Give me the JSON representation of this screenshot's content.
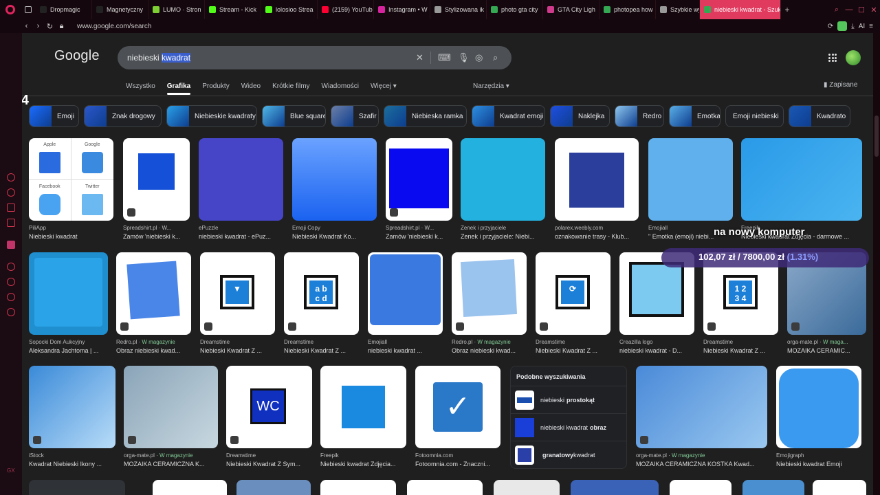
{
  "browser": {
    "tabs": [
      {
        "label": "Dropmagic",
        "color": "#222"
      },
      {
        "label": "Magnetyczny",
        "color": "#222"
      },
      {
        "label": "LUMO · Stron",
        "color": "#7ecf34"
      },
      {
        "label": "Stream - Kick",
        "color": "#53fc18"
      },
      {
        "label": "lolosioo Strea",
        "color": "#53fc18"
      },
      {
        "label": "(2159) YouTub",
        "color": "#ff0033"
      },
      {
        "label": "Instagram • W",
        "color": "#d6249f"
      },
      {
        "label": "Stylizowana ik",
        "color": "#999"
      },
      {
        "label": "photo gta city",
        "color": "#34a853"
      },
      {
        "label": "GTA City Ligh",
        "color": "#d03a8c"
      },
      {
        "label": "photopea how",
        "color": "#34a853"
      },
      {
        "label": "Szybkie wybie",
        "color": "#999"
      },
      {
        "label": "niebieski kwadrat - Szuk",
        "color": "#34a853",
        "active": true
      }
    ],
    "new_tab": "+",
    "url": "www.google.com/search",
    "ai_label": "AI"
  },
  "google": {
    "logo": "Google",
    "query_prefix": "niebieski ",
    "query_selected": "kwadrat",
    "filters": [
      "Wszystko",
      "Grafika",
      "Produkty",
      "Wideo",
      "Krótkie filmy",
      "Wiadomości",
      "Więcej ▾"
    ],
    "active_filter": "Grafika",
    "tools": "Narzędzia ▾",
    "saved": "Zapisane"
  },
  "overlay": {
    "k4": "K",
    "k4_num": "4",
    "line1": "na nowy komputer",
    "amount": "102,07 zł / 7800,00 zł ",
    "pct": "(1.31%)"
  },
  "chips": [
    {
      "label": "Emoji",
      "c": "#1a6cff"
    },
    {
      "label": "Znak drogowy",
      "c": "#2b57c9"
    },
    {
      "label": "Niebieskie kwadraty",
      "c": "#2aa0e8"
    },
    {
      "label": "Blue square",
      "c": "#4fb7e6"
    },
    {
      "label": "Szafir",
      "c": "#6c7fa8"
    },
    {
      "label": "Niebieska ramka",
      "c": "#1b6e9e"
    },
    {
      "label": "Kwadrat emoji",
      "c": "#2e8fe0"
    },
    {
      "label": "Naklejka",
      "c": "#1f4fe0"
    },
    {
      "label": "Redro",
      "c": "#8fc7ee"
    },
    {
      "label": "Emotka",
      "c": "#5aaee6"
    },
    {
      "label": "Emoji niebieski",
      "c": ""
    },
    {
      "label": "Kwadrato",
      "c": "#1a58b5"
    }
  ],
  "row1": [
    {
      "src": "PiliApp",
      "ttl": "Niebieski kwadrat",
      "apple": "Apple",
      "google": "Google",
      "facebook": "Facebook",
      "twitter": "Twitter"
    },
    {
      "src": "Spreadshirt.pl · W...",
      "ttl": "Zamów 'niebieski k..."
    },
    {
      "src": "ePuzzle",
      "ttl": "niebieski kwadrat - ePuz..."
    },
    {
      "src": "Emoji Copy",
      "ttl": "Niebieski Kwadrat Ko..."
    },
    {
      "src": "Spreadshirt.pl · W...",
      "ttl": "Zamów 'niebieski k..."
    },
    {
      "src": "Zenek i przyjaciele",
      "ttl": "Zenek i przyjaciele: Niebi..."
    },
    {
      "src": "polarex.weebly.com",
      "ttl": "oznakowanie trasy - Klub..."
    },
    {
      "src": "Emojiall",
      "ttl": "\" Emotka (emoji) niebi..."
    },
    {
      "src": "Freepik",
      "ttl": "Niebieski kwadrat Zdjęcia - darmowe ..."
    }
  ],
  "row2": [
    {
      "src": "Sopocki Dom Aukcyjny",
      "ttl": "Aleksandra Jachtoma | ..."
    },
    {
      "src": "Redro.pl · ",
      "mag": "W magazynie",
      "ttl": "Obraz niebieski kwad..."
    },
    {
      "src": "Dreamstime",
      "ttl": "Niebieski Kwadrat Z ..."
    },
    {
      "src": "Dreamstime",
      "ttl": "Niebieski Kwadrat Z ...",
      "txt": "a b\nc d"
    },
    {
      "src": "Emojiall",
      "ttl": "niebieski kwadrat ..."
    },
    {
      "src": "Redro.pl · ",
      "mag": "W magazynie",
      "ttl": "Obraz niebieski kwad..."
    },
    {
      "src": "Dreamstime",
      "ttl": "Niebieski Kwadrat Z ..."
    },
    {
      "src": "Creazilla logo",
      "ttl": "niebieski kwadrat - D..."
    },
    {
      "src": "Dreamstime",
      "ttl": "Niebieski Kwadrat Z ...",
      "txt": "1 2\n3 4"
    },
    {
      "src": "orga-mate.pl · ",
      "mag": "W maga...",
      "ttl": "MOZAIKA CERAMIC..."
    }
  ],
  "row3": [
    {
      "src": "iStock",
      "ttl": "Kwadrat Niebieski Ikony ..."
    },
    {
      "src": "orga-mate.pl · ",
      "mag": "W magazynie",
      "ttl": "MOZAIKA CERAMICZNA K..."
    },
    {
      "src": "Dreamstime",
      "ttl": "Niebieski Kwadrat Z Sym...",
      "txt": "WC"
    },
    {
      "src": "Freepik",
      "ttl": "Niebieski kwadrat Zdjęcia..."
    },
    {
      "src": "Fotoomnia.com",
      "ttl": "Fotoomnia.com - Znaczni..."
    },
    {
      "src": "orga-mate.pl · ",
      "mag": "W magazynie",
      "ttl": "MOZAIKA CERAMICZNA KOSTKA Kwad..."
    },
    {
      "src": "Emojigraph",
      "ttl": "Niebieski kwadrat Emoji"
    }
  ],
  "related": {
    "heading": "Podobne wyszukiwania",
    "items": [
      {
        "pre": "niebieski",
        "bold": "prostokąt",
        "post": ""
      },
      {
        "pre": "niebieski kwadrat",
        "bold": "obraz",
        "post": ""
      },
      {
        "pre": "",
        "bold": "granatowy",
        "post": " kwadrat"
      }
    ]
  },
  "colors": {
    "accent": "#e13a5f",
    "search_bg": "#4d5156",
    "page_bg": "#1f1f1f"
  }
}
